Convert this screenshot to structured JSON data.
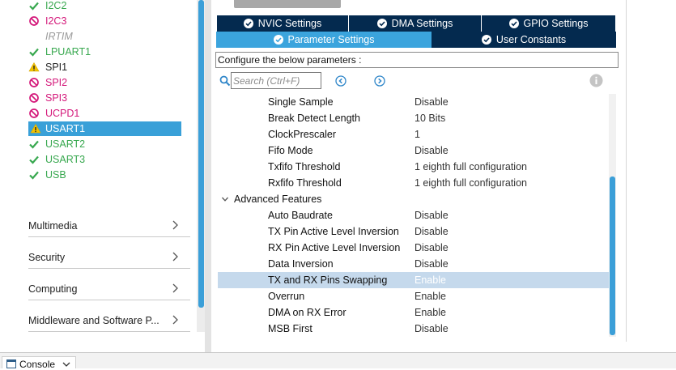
{
  "peripherals": [
    {
      "label": "I2C2",
      "status": "ok"
    },
    {
      "label": "I2C3",
      "status": "disabled"
    },
    {
      "label": "IRTIM",
      "status": "unavailable"
    },
    {
      "label": "LPUART1",
      "status": "ok"
    },
    {
      "label": "SPI1",
      "status": "warning"
    },
    {
      "label": "SPI2",
      "status": "disabled"
    },
    {
      "label": "SPI3",
      "status": "disabled"
    },
    {
      "label": "UCPD1",
      "status": "disabled"
    },
    {
      "label": "USART1",
      "status": "warning",
      "selected": true
    },
    {
      "label": "USART2",
      "status": "ok"
    },
    {
      "label": "USART3",
      "status": "ok"
    },
    {
      "label": "USB",
      "status": "ok"
    }
  ],
  "categories": [
    "Multimedia",
    "Security",
    "Computing",
    "Middleware and Software P..."
  ],
  "tabs": {
    "nvic": "NVIC Settings",
    "dma": "DMA Settings",
    "gpio": "GPIO Settings",
    "parameter": "Parameter Settings",
    "user_constants": "User Constants"
  },
  "configure_label": "Configure the below parameters :",
  "search": {
    "placeholder": "Search (Ctrl+F)"
  },
  "params": [
    {
      "name": "Single Sample",
      "value": "Disable"
    },
    {
      "name": "Break Detect Length",
      "value": "10 Bits"
    },
    {
      "name": "ClockPrescaler",
      "value": "1"
    },
    {
      "name": "Fifo Mode",
      "value": "Disable"
    },
    {
      "name": "Txfifo Threshold",
      "value": "1 eighth full configuration"
    },
    {
      "name": "Rxfifo Threshold",
      "value": "1 eighth full configuration"
    },
    {
      "name": "Advanced Features",
      "value": "",
      "section": true
    },
    {
      "name": "Auto Baudrate",
      "value": "Disable"
    },
    {
      "name": "TX Pin Active Level Inversion",
      "value": "Disable"
    },
    {
      "name": "RX Pin Active Level Inversion",
      "value": "Disable"
    },
    {
      "name": "Data Inversion",
      "value": "Disable"
    },
    {
      "name": "TX and RX Pins Swapping",
      "value": "Enable",
      "selected": true
    },
    {
      "name": "Overrun",
      "value": "Enable"
    },
    {
      "name": "DMA on RX Error",
      "value": "Enable"
    },
    {
      "name": "MSB First",
      "value": "Disable"
    }
  ],
  "console": {
    "label": "Console"
  },
  "colors": {
    "ok": "#38a84f",
    "disabled": "#d4187a",
    "warning": "#f2c200",
    "selected": "#39a0d8",
    "tab_dark": "#042a4f",
    "tab_active": "#3ba4dd"
  },
  "icons": {
    "ok": "check-icon",
    "disabled": "prohibited-icon",
    "warning": "warning-icon"
  }
}
